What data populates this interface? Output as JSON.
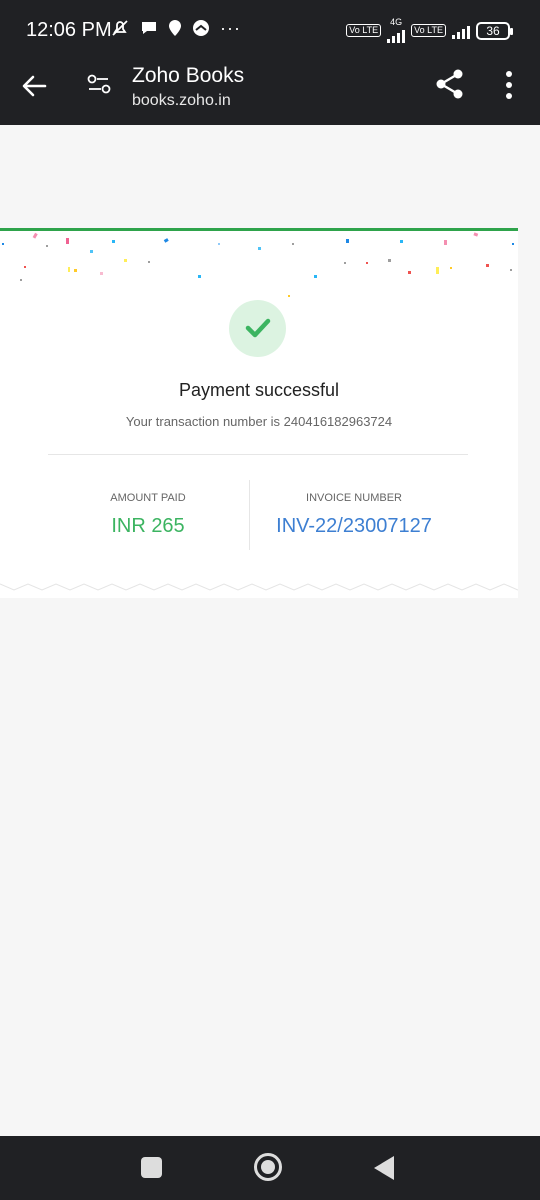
{
  "status_bar": {
    "time": "12:06 PM",
    "dots": "···",
    "network_4g": "4G",
    "lte_badge_1": "Vo LTE",
    "lte_badge_2": "Vo LTE",
    "battery": "36"
  },
  "app_bar": {
    "title": "Zoho Books",
    "url": "books.zoho.in"
  },
  "receipt": {
    "title": "Payment successful",
    "transaction_prefix": "Your transaction number is",
    "transaction_number": "240416182963724",
    "amount_label": "AMOUNT PAID",
    "amount_value": "INR 265",
    "invoice_label": "INVOICE NUMBER",
    "invoice_value": "INV-22/23007127"
  },
  "colors": {
    "accent_green": "#3cb461",
    "invoice_blue": "#3d7fd2",
    "bar_dark": "#202124"
  }
}
